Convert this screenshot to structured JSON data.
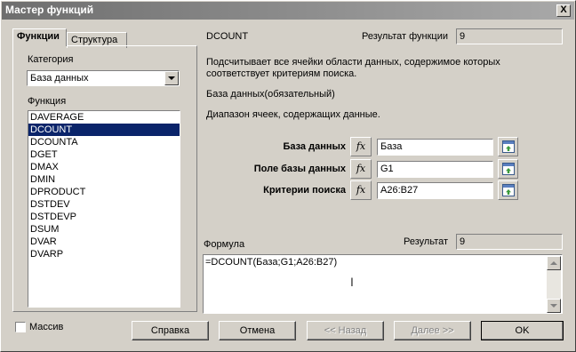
{
  "window": {
    "title": "Мастер функций",
    "close_label": "X"
  },
  "tabs": [
    {
      "label": "Функции"
    },
    {
      "label": "Структура"
    }
  ],
  "category": {
    "label": "Категория",
    "value": "База данных"
  },
  "functions": {
    "label": "Функция",
    "items": [
      "DAVERAGE",
      "DCOUNT",
      "DCOUNTA",
      "DGET",
      "DMAX",
      "DMIN",
      "DPRODUCT",
      "DSTDEV",
      "DSTDEVP",
      "DSUM",
      "DVAR",
      "DVARP"
    ],
    "selected": "DCOUNT"
  },
  "detail": {
    "function_name": "DCOUNT",
    "result_label": "Результат функции",
    "result_value": "9",
    "description": "Подсчитывает все ячейки области данных, содержимое которых соответствует критериям поиска.",
    "param_title": "База данных(обязательный)",
    "param_desc": "Диапазон ячеек, содержащих данные."
  },
  "params": [
    {
      "label": "База данных",
      "value": "База"
    },
    {
      "label": "Поле базы данных",
      "value": "G1"
    },
    {
      "label": "Критерии поиска",
      "value": "A26:B27"
    }
  ],
  "fx_label": "fx",
  "formula": {
    "label": "Формула",
    "result_label": "Результат",
    "result_value": "9",
    "text": "=DCOUNT(База;G1;A26:B27)"
  },
  "array_checkbox": {
    "label": "Массив",
    "checked": false
  },
  "buttons": {
    "help": "Справка",
    "cancel": "Отмена",
    "back": "<< Назад",
    "next": "Далее >>",
    "ok": "OK"
  }
}
